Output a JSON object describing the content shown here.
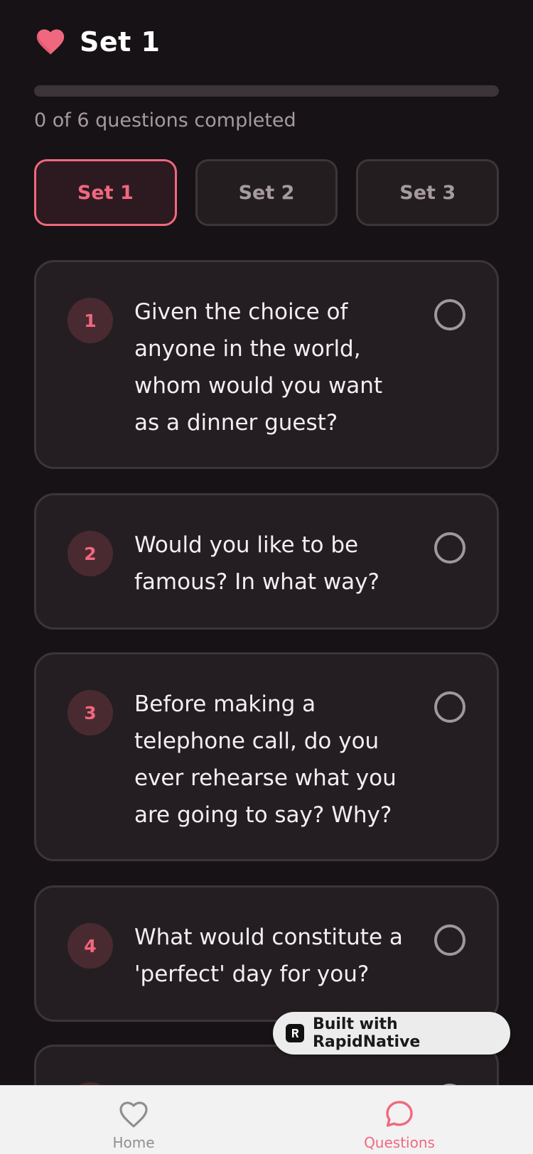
{
  "header": {
    "title": "Set 1",
    "icon": "heart-icon"
  },
  "progress": {
    "completed": 0,
    "total": 6,
    "fraction": 0,
    "text": "0 of 6 questions completed"
  },
  "tabs": [
    {
      "label": "Set 1",
      "active": true
    },
    {
      "label": "Set 2",
      "active": false
    },
    {
      "label": "Set 3",
      "active": false
    }
  ],
  "questions": [
    {
      "number": "1",
      "text": "Given the choice of anyone in the world, whom would you want as a dinner guest?",
      "checked": false
    },
    {
      "number": "2",
      "text": "Would you like to be famous? In what way?",
      "checked": false
    },
    {
      "number": "3",
      "text": "Before making a telephone call, do you ever rehearse what you are going to say? Why?",
      "checked": false
    },
    {
      "number": "4",
      "text": "What would constitute a 'perfect' day for you?",
      "checked": false
    }
  ],
  "badge": {
    "text": "Built with RapidNative"
  },
  "tabbar": {
    "home": {
      "label": "Home",
      "icon": "heart-outline-icon"
    },
    "questions": {
      "label": "Questions",
      "icon": "chat-bubble-icon",
      "active": true
    }
  },
  "colors": {
    "background": "#171215",
    "accent": "#f0687f",
    "card": "#241e22",
    "muted_text": "#a59aa0"
  }
}
